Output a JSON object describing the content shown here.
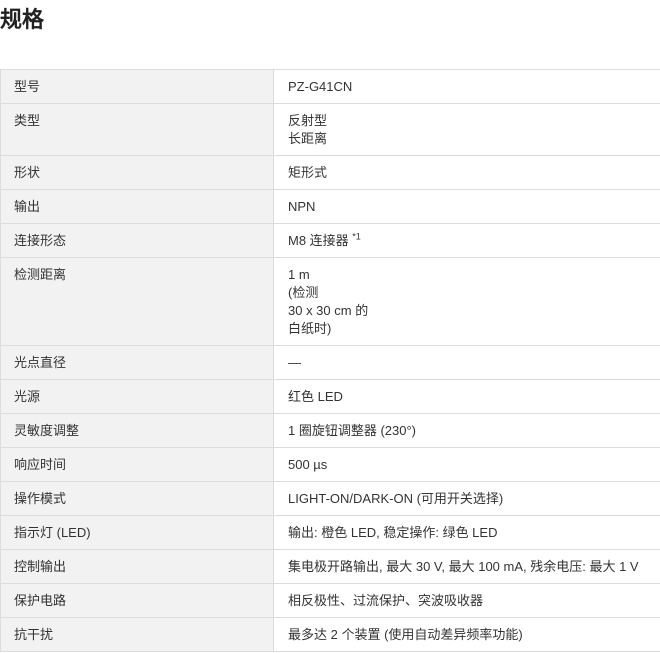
{
  "page_title": "规格",
  "specs": [
    {
      "label": "型号",
      "value_lines": [
        "PZ-G41CN"
      ]
    },
    {
      "label": "类型",
      "value_lines": [
        "反射型",
        "长距离"
      ]
    },
    {
      "label": "形状",
      "value_lines": [
        "矩形式"
      ]
    },
    {
      "label": "输出",
      "value_lines": [
        "NPN"
      ]
    },
    {
      "label": "连接形态",
      "value_lines": [
        "M8 连接器"
      ],
      "note": "*1"
    },
    {
      "label": "检测距离",
      "value_lines": [
        "1 m",
        "(检测",
        "30 x 30 cm 的",
        "白纸时)"
      ]
    },
    {
      "label": "光点直径",
      "value_lines": [
        "—"
      ]
    },
    {
      "label": "光源",
      "value_lines": [
        "红色 LED"
      ]
    },
    {
      "label": "灵敏度调整",
      "value_lines": [
        "1 圈旋钮调整器 (230°)"
      ]
    },
    {
      "label": "响应时间",
      "value_lines": [
        "500 µs"
      ]
    },
    {
      "label": "操作模式",
      "value_lines": [
        "LIGHT-ON/DARK-ON (可用开关选择)"
      ]
    },
    {
      "label": "指示灯 (LED)",
      "value_lines": [
        "输出: 橙色 LED, 稳定操作: 绿色 LED"
      ]
    },
    {
      "label": "控制输出",
      "value_lines": [
        "集电极开路输出, 最大 30 V, 最大 100 mA, 残余电压: 最大 1 V"
      ]
    },
    {
      "label": "保护电路",
      "value_lines": [
        "相反极性、过流保护、突波吸收器"
      ]
    },
    {
      "label": "抗干扰",
      "value_lines": [
        "最多达 2 个装置 (使用自动差异频率功能)"
      ]
    }
  ]
}
